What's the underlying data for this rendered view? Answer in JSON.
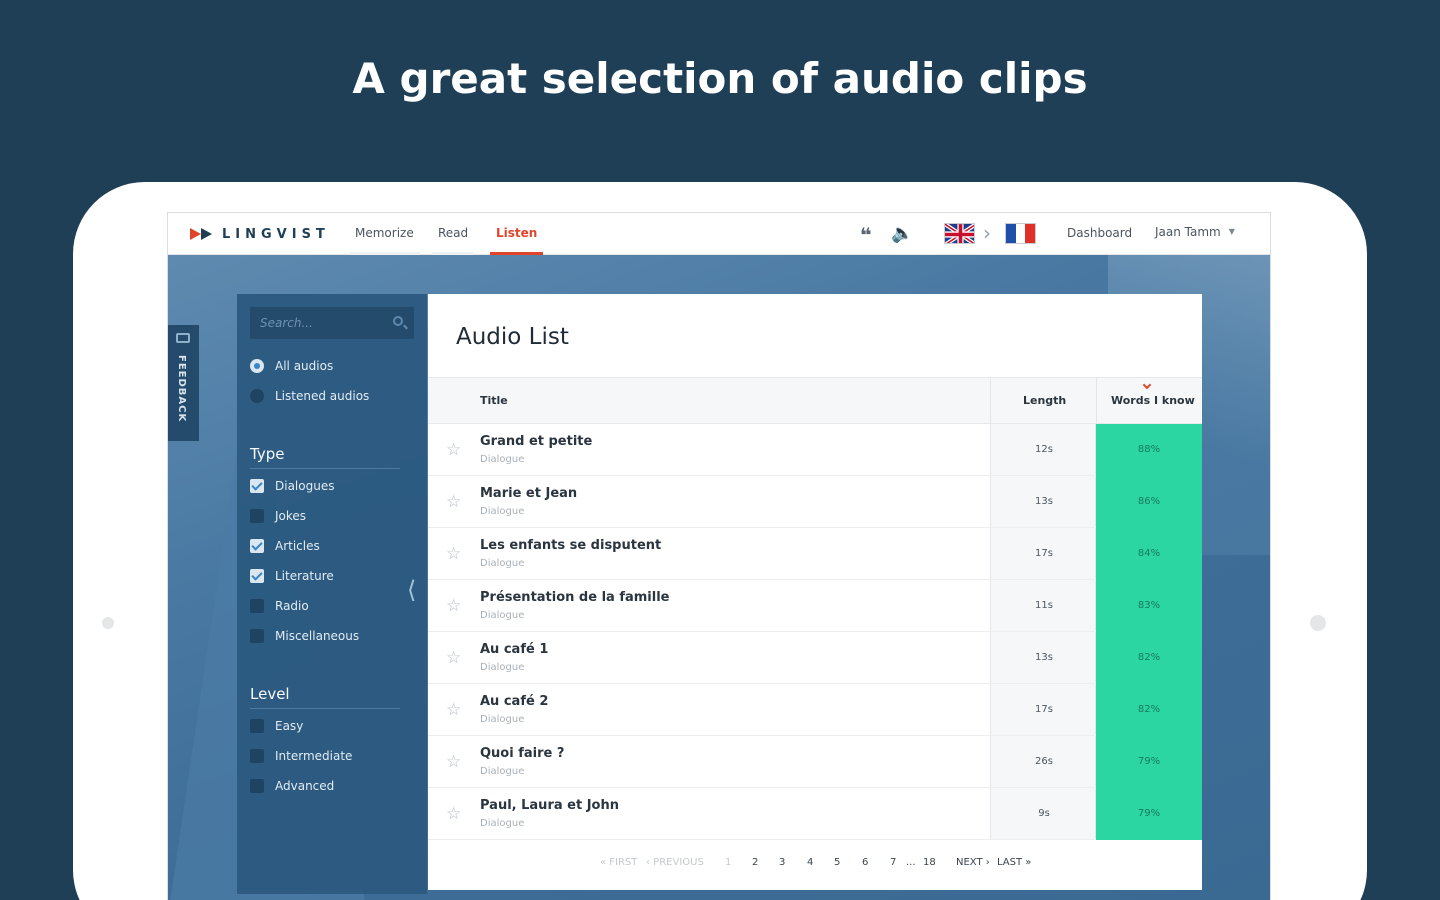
{
  "headline": "A great selection of audio clips",
  "brand": {
    "name": "LINGVIST",
    "accent": "#e0452a",
    "primary": "#1f3f57"
  },
  "nav": {
    "items": [
      "Memorize",
      "Read",
      "Listen"
    ],
    "active": "Listen",
    "icons": [
      "quote-icon",
      "speaker-icon"
    ],
    "source_flag": "uk-flag-icon",
    "target_flag": "france-flag-icon",
    "dashboard": "Dashboard",
    "user": "Jaan Tamm"
  },
  "feedback": {
    "label": "FEEDBACK"
  },
  "sidebar": {
    "search_placeholder": "Search...",
    "filters": [
      {
        "label": "All audios",
        "selected": true
      },
      {
        "label": "Listened audios",
        "selected": false
      }
    ],
    "type_title": "Type",
    "types": [
      {
        "label": "Dialogues",
        "checked": true
      },
      {
        "label": "Jokes",
        "checked": false
      },
      {
        "label": "Articles",
        "checked": true
      },
      {
        "label": "Literature",
        "checked": true
      },
      {
        "label": "Radio",
        "checked": false
      },
      {
        "label": "Miscellaneous",
        "checked": false
      }
    ],
    "level_title": "Level",
    "levels": [
      {
        "label": "Easy",
        "checked": false
      },
      {
        "label": "Intermediate",
        "checked": false
      },
      {
        "label": "Advanced",
        "checked": false
      }
    ]
  },
  "audio_list": {
    "title": "Audio List",
    "columns": {
      "title": "Title",
      "length": "Length",
      "words": "Words I know"
    },
    "highlight_color": "#2bd6a3",
    "rows": [
      {
        "title": "Grand et petite",
        "type": "Dialogue",
        "length": "12s",
        "known": "88%"
      },
      {
        "title": "Marie et Jean",
        "type": "Dialogue",
        "length": "13s",
        "known": "86%"
      },
      {
        "title": "Les enfants se disputent",
        "type": "Dialogue",
        "length": "17s",
        "known": "84%"
      },
      {
        "title": "Présentation de la famille",
        "type": "Dialogue",
        "length": "11s",
        "known": "83%"
      },
      {
        "title": "Au café 1",
        "type": "Dialogue",
        "length": "13s",
        "known": "82%"
      },
      {
        "title": "Au café 2",
        "type": "Dialogue",
        "length": "17s",
        "known": "82%"
      },
      {
        "title": "Quoi faire ?",
        "type": "Dialogue",
        "length": "26s",
        "known": "79%"
      },
      {
        "title": "Paul, Laura et John",
        "type": "Dialogue",
        "length": "9s",
        "known": "79%"
      }
    ]
  },
  "pagination": {
    "first": "« FIRST",
    "previous": "‹ PREVIOUS",
    "pages": [
      "1",
      "2",
      "3",
      "4",
      "5",
      "6",
      "7"
    ],
    "ellipsis": "...",
    "last_page": "18",
    "next": "NEXT ›",
    "last": "LAST »",
    "current": "1"
  }
}
